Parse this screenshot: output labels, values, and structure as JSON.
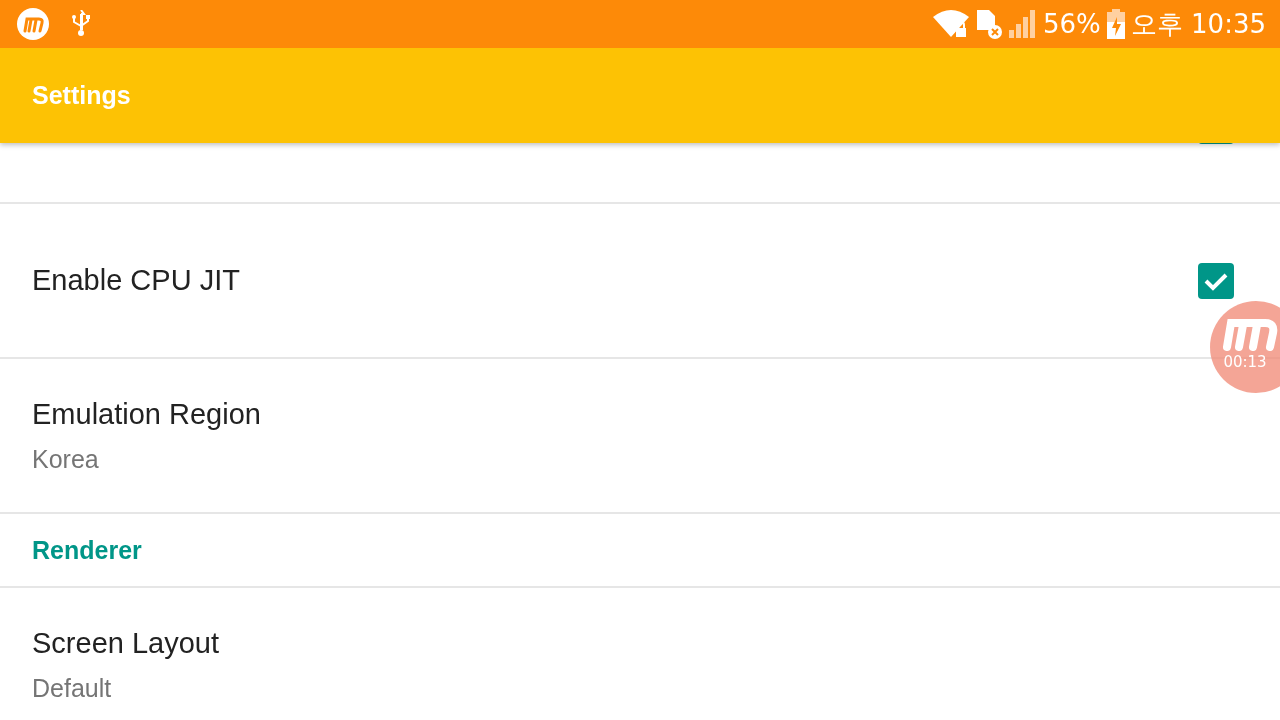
{
  "status_bar": {
    "battery_percent": "56%",
    "time": "오후 10:35"
  },
  "app_bar": {
    "title": "Settings"
  },
  "preferences": [
    {
      "kind": "checkbox",
      "checked": true
    },
    {
      "kind": "checkbox",
      "title": "Enable CPU JIT",
      "checked": true
    },
    {
      "kind": "list",
      "title": "Emulation Region",
      "summary": "Korea"
    },
    {
      "kind": "category",
      "title": "Renderer"
    },
    {
      "kind": "list",
      "title": "Screen Layout",
      "summary": "Default"
    }
  ],
  "recorder": {
    "elapsed": "00:13"
  }
}
